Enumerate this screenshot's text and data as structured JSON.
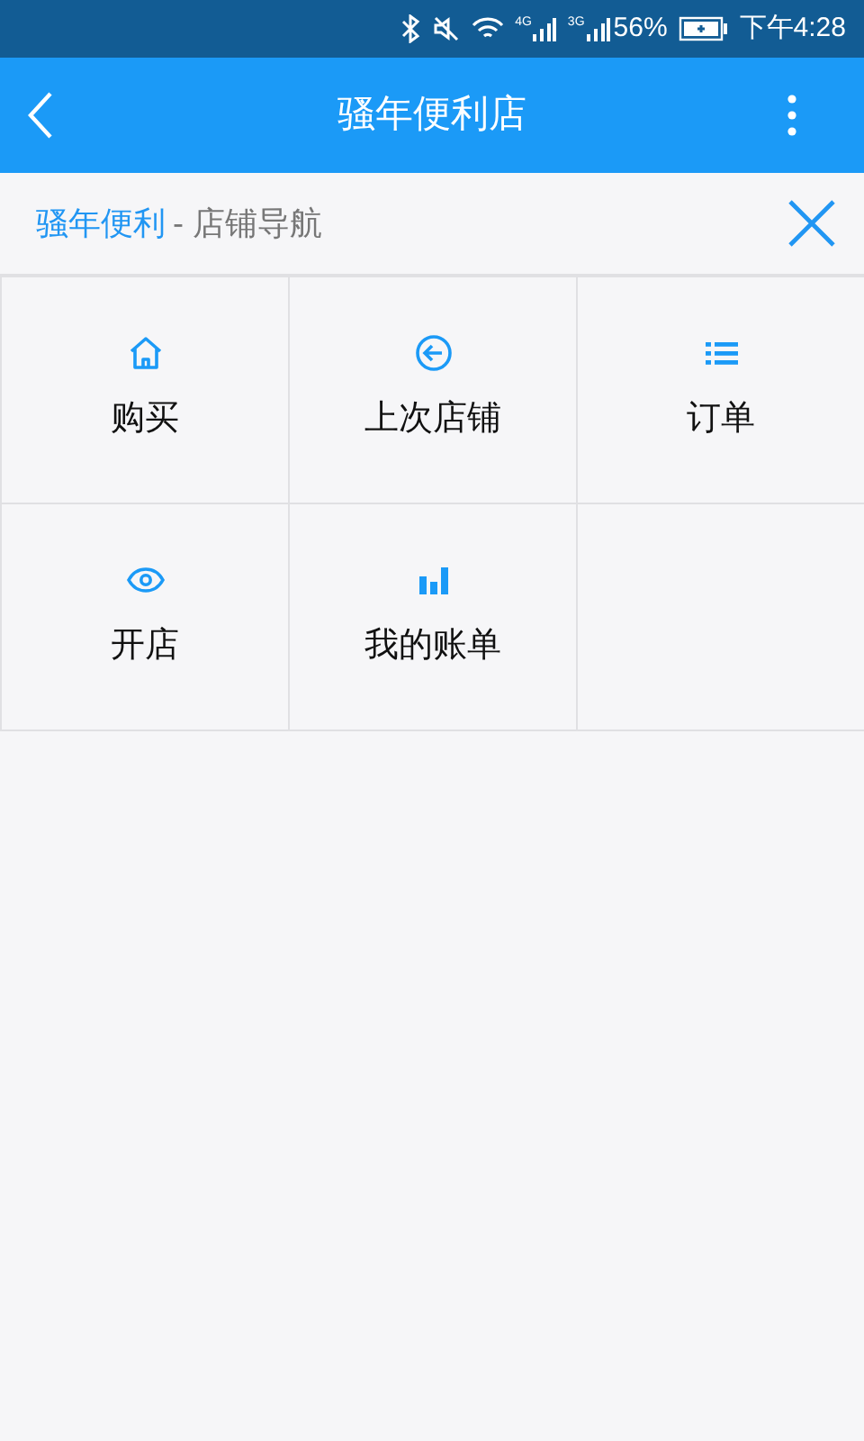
{
  "status_bar": {
    "network_1": "4G",
    "network_2": "3G",
    "battery": "56%",
    "time": "下午4:28"
  },
  "app_bar": {
    "title": "骚年便利店"
  },
  "header": {
    "store_name": "骚年便利",
    "subtitle": "- 店铺导航"
  },
  "menu": [
    {
      "kind": "home",
      "label": "购买"
    },
    {
      "kind": "back",
      "label": "上次店铺"
    },
    {
      "kind": "list",
      "label": "订单"
    },
    {
      "kind": "eye",
      "label": "开店"
    },
    {
      "kind": "bars",
      "label": "我的账单"
    }
  ]
}
